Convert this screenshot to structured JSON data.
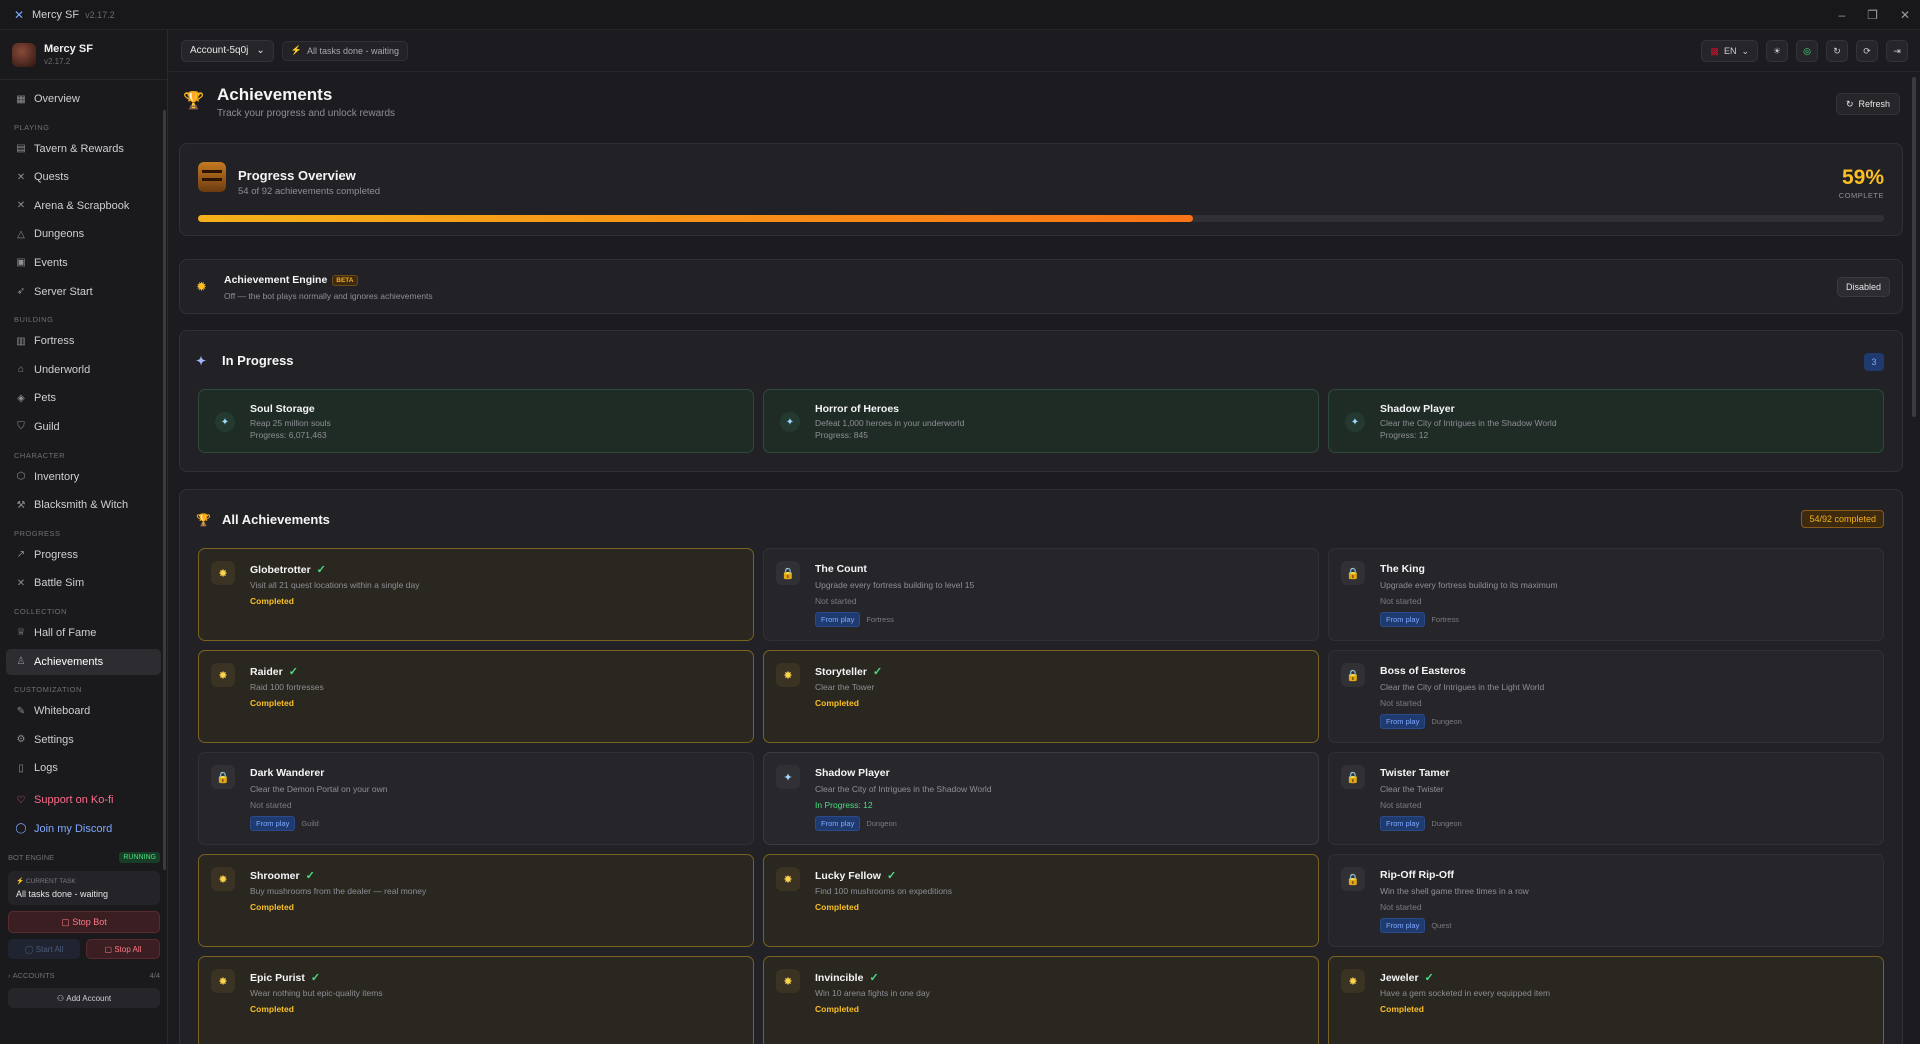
{
  "titlebar": {
    "app": "Mercy SF",
    "version": "v2.17.2"
  },
  "brand": {
    "name": "Mercy SF",
    "version": "v2.17.2"
  },
  "nav": {
    "overview": "Overview",
    "sections": {
      "playing": "PLAYING",
      "building": "BUILDING",
      "character": "CHARACTER",
      "progress": "PROGRESS",
      "collection": "COLLECTION",
      "customization": "CUSTOMIZATION"
    },
    "items": {
      "tavern": "Tavern & Rewards",
      "quests": "Quests",
      "arena": "Arena & Scrapbook",
      "dungeons": "Dungeons",
      "events": "Events",
      "server_start": "Server Start",
      "fortress": "Fortress",
      "underworld": "Underworld",
      "pets": "Pets",
      "guild": "Guild",
      "inventory": "Inventory",
      "blacksmith": "Blacksmith & Witch",
      "progress": "Progress",
      "battle_sim": "Battle Sim",
      "hall_of_fame": "Hall of Fame",
      "achievements": "Achievements",
      "whiteboard": "Whiteboard",
      "settings": "Settings",
      "logs": "Logs",
      "kofi": "Support on Ko-fi",
      "discord": "Join my Discord"
    }
  },
  "bot": {
    "engine_label": "BOT ENGINE",
    "engine_status": "RUNNING",
    "current_task_label": "CURRENT TASK",
    "current_task": "All tasks done - waiting",
    "stop_bot": "Stop Bot",
    "start_all": "Start All",
    "stop_all": "Stop All",
    "accounts_label": "ACCOUNTS",
    "accounts_count": "4/4",
    "add_account": "Add Account"
  },
  "topbar": {
    "account": "Account-5q0j",
    "status": "All tasks done - waiting",
    "lang": "EN"
  },
  "page": {
    "title": "Achievements",
    "subtitle": "Track your progress and unlock rewards",
    "refresh": "Refresh"
  },
  "overview": {
    "title": "Progress Overview",
    "subtitle": "54 of 92 achievements completed",
    "percent": "59%",
    "percent_label": "COMPLETE",
    "fraction": 0.59
  },
  "engine": {
    "title": "Achievement Engine",
    "beta": "BETA",
    "desc": "Off — the bot plays normally and ignores achievements",
    "state": "Disabled"
  },
  "in_progress": {
    "title": "In Progress",
    "count": "3",
    "items": [
      {
        "title": "Soul Storage",
        "desc": "Reap 25 million souls",
        "progress": "Progress: 6,071,463"
      },
      {
        "title": "Horror of Heroes",
        "desc": "Defeat 1,000 heroes in your underworld",
        "progress": "Progress: 845"
      },
      {
        "title": "Shadow Player",
        "desc": "Clear the City of Intrigues in the Shadow World",
        "progress": "Progress: 12"
      }
    ]
  },
  "all": {
    "title": "All Achievements",
    "badge": "54/92 completed",
    "from_play": "From play",
    "items": [
      {
        "title": "Globetrotter",
        "desc": "Visit all 21 quest locations within a single day",
        "status": "Completed",
        "state": "done",
        "category": ""
      },
      {
        "title": "The Count",
        "desc": "Upgrade every fortress building to level 15",
        "status": "Not started",
        "state": "locked",
        "category": "Fortress"
      },
      {
        "title": "The King",
        "desc": "Upgrade every fortress building to its maximum",
        "status": "Not started",
        "state": "locked",
        "category": "Fortress"
      },
      {
        "title": "Raider",
        "desc": "Raid 100 fortresses",
        "status": "Completed",
        "state": "done",
        "category": ""
      },
      {
        "title": "Storyteller",
        "desc": "Clear the Tower",
        "status": "Completed",
        "state": "done",
        "category": ""
      },
      {
        "title": "Boss of Easteros",
        "desc": "Clear the City of Intrigues in the Light World",
        "status": "Not started",
        "state": "locked",
        "category": "Dungeon"
      },
      {
        "title": "Dark Wanderer",
        "desc": "Clear the Demon Portal on your own",
        "status": "Not started",
        "state": "locked",
        "category": "Guild"
      },
      {
        "title": "Shadow Player",
        "desc": "Clear the City of Intrigues in the Shadow World",
        "status": "In Progress: 12",
        "state": "prog",
        "category": "Dungeon"
      },
      {
        "title": "Twister Tamer",
        "desc": "Clear the Twister",
        "status": "Not started",
        "state": "locked",
        "category": "Dungeon"
      },
      {
        "title": "Shroomer",
        "desc": "Buy mushrooms from the dealer — real money",
        "status": "Completed",
        "state": "done",
        "category": ""
      },
      {
        "title": "Lucky Fellow",
        "desc": "Find 100 mushrooms on expeditions",
        "status": "Completed",
        "state": "done",
        "category": ""
      },
      {
        "title": "Rip-Off Rip-Off",
        "desc": "Win the shell game three times in a row",
        "status": "Not started",
        "state": "locked",
        "category": "Quest"
      },
      {
        "title": "Epic Purist",
        "desc": "Wear nothing but epic-quality items",
        "status": "Completed",
        "state": "done",
        "category": ""
      },
      {
        "title": "Invincible",
        "desc": "Win 10 arena fights in one day",
        "status": "Completed",
        "state": "done",
        "category": ""
      },
      {
        "title": "Jeweler",
        "desc": "Have a gem socketed in every equipped item",
        "status": "Completed",
        "state": "done",
        "category": ""
      }
    ]
  }
}
